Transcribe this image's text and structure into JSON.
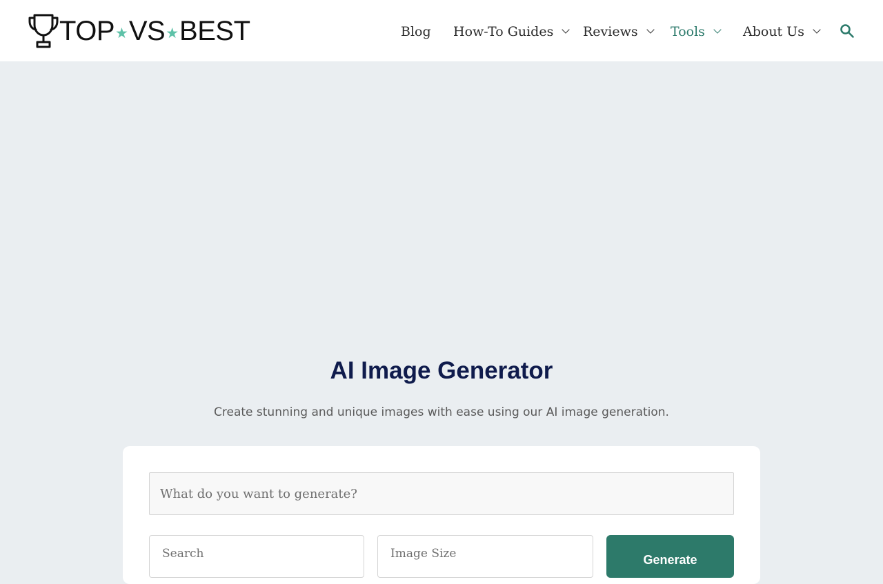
{
  "header": {
    "logo": {
      "word1": "TOP",
      "word2": "VS",
      "word3": "BEST",
      "star_glyph": "★",
      "star_color": "#5ec2a8"
    },
    "nav": {
      "items": [
        {
          "label": "Blog",
          "has_dropdown": false
        },
        {
          "label": "How-To Guides",
          "has_dropdown": true
        },
        {
          "label": "Reviews",
          "has_dropdown": true
        },
        {
          "label": "Tools",
          "has_dropdown": true,
          "active": true
        },
        {
          "label": "About Us",
          "has_dropdown": true
        }
      ],
      "search_icon": "search-icon",
      "accent_color": "#2c7a6b"
    }
  },
  "main": {
    "title": "AI Image Generator",
    "subtitle": "Create stunning and unique images with ease using our AI image generation.",
    "form": {
      "prompt_placeholder": "What do you want to generate?",
      "style_select": "Search",
      "size_select": "Image Size",
      "generate_label": "Generate",
      "button_color": "#2d7a6a"
    }
  },
  "colors": {
    "page_background": "#eaeef1",
    "title_color": "#0f1b4c"
  }
}
